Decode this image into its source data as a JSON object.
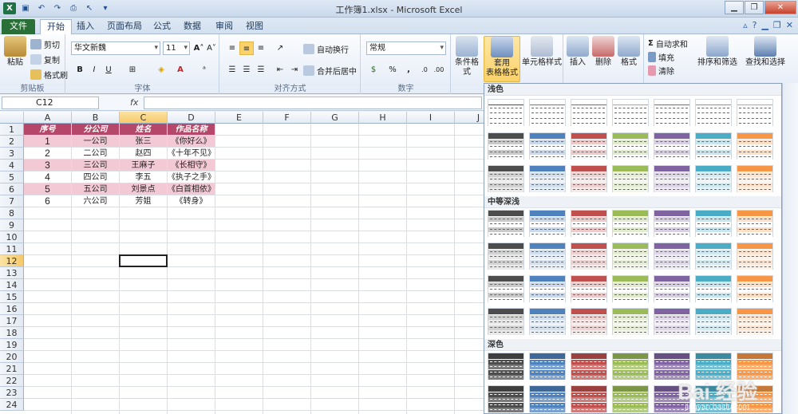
{
  "window": {
    "title": "工作簿1.xlsx - Microsoft Excel"
  },
  "tabs": [
    "文件",
    "开始",
    "插入",
    "页面布局",
    "公式",
    "数据",
    "审阅",
    "视图"
  ],
  "ribbon": {
    "clipboard": {
      "label": "剪贴板",
      "paste": "粘贴",
      "cut": "剪切",
      "copy": "复制",
      "format_painter": "格式刷"
    },
    "font": {
      "label": "字体",
      "name": "华文新魏",
      "size": "11",
      "bold": "B",
      "italic": "I",
      "underline": "U"
    },
    "alignment": {
      "label": "对齐方式",
      "wrap": "自动换行",
      "merge": "合并后居中"
    },
    "number": {
      "label": "数字",
      "format": "常规",
      "percent": "%",
      "comma": ","
    },
    "styles": {
      "conditional": "条件格式",
      "format_as_table": "套用\n表格格式",
      "cell_styles": "单元格样式"
    },
    "cells": {
      "insert": "插入",
      "delete": "删除",
      "format": "格式"
    },
    "editing": {
      "autosum": "自动求和",
      "fill": "填充",
      "clear": "清除",
      "sort_filter": "排序和筛选",
      "find_select": "查找和选择"
    }
  },
  "formula_bar": {
    "name_box": "C12",
    "fx": "fx",
    "value": ""
  },
  "sheet": {
    "columns": [
      "A",
      "B",
      "C",
      "D",
      "E",
      "F",
      "G",
      "H",
      "I",
      "J"
    ],
    "rows": [
      "1",
      "2",
      "3",
      "4",
      "5",
      "6",
      "7",
      "8",
      "9",
      "10",
      "11",
      "12",
      "13",
      "14",
      "15",
      "16",
      "17",
      "18",
      "19",
      "20",
      "21",
      "22",
      "23",
      "24"
    ],
    "selected_cell": "C12",
    "header": [
      "序号",
      "分公司",
      "姓名",
      "作品名称"
    ],
    "data": [
      [
        "1",
        "一公司",
        "张三",
        "《你好么》"
      ],
      [
        "2",
        "二公司",
        "赵四",
        "《十年不见》"
      ],
      [
        "3",
        "三公司",
        "王麻子",
        "《长相守》"
      ],
      [
        "4",
        "四公司",
        "李五",
        "《执子之手》"
      ],
      [
        "5",
        "五公司",
        "刘景点",
        "《白首相依》"
      ],
      [
        "6",
        "六公司",
        "芳姐",
        "《转身》"
      ]
    ],
    "colors": {
      "header_bg": "#b5476a",
      "band_bg": "#f2c9d5"
    }
  },
  "gallery": {
    "sections": [
      "浅色",
      "中等深浅",
      "深色"
    ],
    "palette": [
      "#4d4d4d",
      "#4f81bd",
      "#c0504d",
      "#9bbb59",
      "#8064a2",
      "#4bacc6",
      "#f79646"
    ]
  },
  "watermark": {
    "text": "Bai 经验",
    "url": "jingyan.baidu.com"
  }
}
